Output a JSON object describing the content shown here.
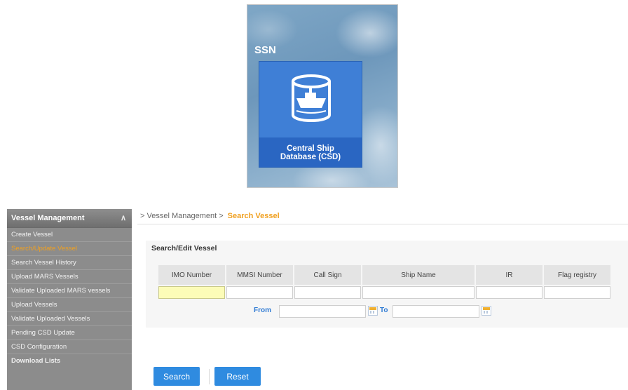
{
  "logo": {
    "brand": "SSN",
    "caption_line1": "Central Ship",
    "caption_line2": "Database (CSD)"
  },
  "sidebar": {
    "header": "Vessel Management",
    "collapse_icon": "double-chevron-up-icon",
    "items": [
      {
        "label": "Create Vessel",
        "active": false
      },
      {
        "label": "Search/Update Vessel",
        "active": true
      },
      {
        "label": "Search Vessel History",
        "active": false
      },
      {
        "label": "Upload MARS Vessels",
        "active": false
      },
      {
        "label": "Validate Uploaded MARS vessels",
        "active": false
      },
      {
        "label": "Upload Vessels",
        "active": false
      },
      {
        "label": "Validate Uploaded Vessels",
        "active": false
      },
      {
        "label": "Pending CSD Update",
        "active": false
      },
      {
        "label": "CSD Configuration",
        "active": false
      },
      {
        "label": "Download Lists",
        "active": false
      }
    ]
  },
  "breadcrumb": {
    "prefix": "> Vessel Management >",
    "current": "Search Vessel"
  },
  "panel": {
    "title": "Search/Edit Vessel",
    "columns": [
      "IMO Number",
      "MMSI Number",
      "Call Sign",
      "Ship Name",
      "IR",
      "Flag registry"
    ],
    "from_label": "From",
    "to_label": "To"
  },
  "buttons": {
    "search": "Search",
    "reset": "Reset"
  },
  "colors": {
    "accent": "#2f8be0",
    "active_menu": "#f0a020",
    "sidebar_bg": "#8c8c8c"
  }
}
